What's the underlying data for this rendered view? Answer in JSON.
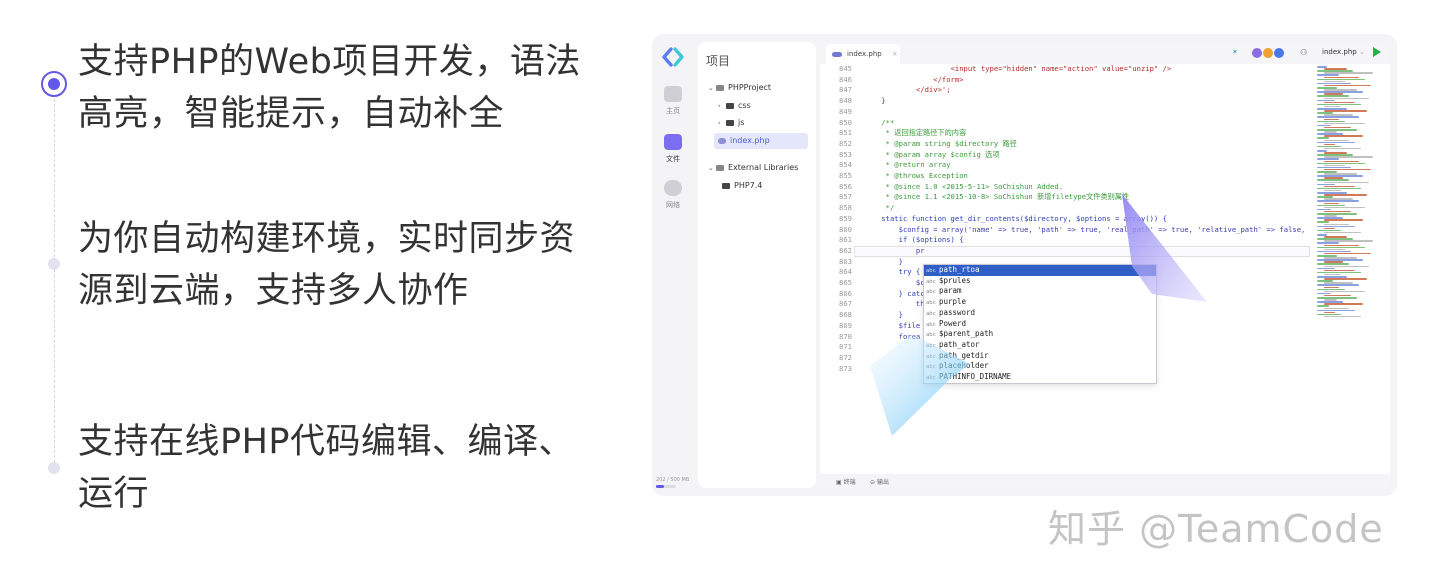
{
  "features": [
    {
      "text": "支持PHP的Web项目开发，语法高亮，智能提示，自动补全",
      "active": true
    },
    {
      "text": "为你自动构建环境，实时同步资源到云端，支持多人协作",
      "active": false
    },
    {
      "text": "支持在线PHP代码编辑、编译、运行",
      "active": false
    }
  ],
  "feature_lines": [
    [
      "支持PHP的Web项目开发，语法",
      "高亮，智能提示，自动补全"
    ],
    [
      "为你自动构建环境，实时同步资",
      "源到云端，支持多人协作"
    ],
    [
      "支持在线PHP代码编辑、编译、",
      "运行"
    ]
  ],
  "ide": {
    "rail": [
      {
        "label": "主页",
        "icon": "home-icon"
      },
      {
        "label": "文件",
        "icon": "folder-icon"
      },
      {
        "label": "网络",
        "icon": "cloud-icon"
      }
    ],
    "storage": "202 / 500 MB",
    "storage_used_fraction": 0.4,
    "tree_title": "项目",
    "tree": [
      {
        "label": "PHPProject",
        "type": "project"
      },
      {
        "label": "css",
        "type": "folder"
      },
      {
        "label": "js",
        "type": "folder"
      },
      {
        "label": "index.php",
        "type": "file"
      },
      {
        "label": "External Libraries",
        "type": "project"
      },
      {
        "label": "PHP7.4",
        "type": "folder"
      }
    ],
    "tab": "index.php",
    "tab_close": "×",
    "file_select": "index.php",
    "code": [
      {
        "n": "845",
        "t": "                    <input type=\"hidden\" name=\"action\" value=\"unzip\" />"
      },
      {
        "n": "846",
        "t": "                </form>"
      },
      {
        "n": "847",
        "t": "            </div>';"
      },
      {
        "n": "848",
        "t": "    }"
      },
      {
        "n": "849",
        "t": ""
      },
      {
        "n": "850",
        "t": "    /**"
      },
      {
        "n": "851",
        "t": "     * 返回指定路径下的内容"
      },
      {
        "n": "852",
        "t": "     * @param string $directory 路径"
      },
      {
        "n": "853",
        "t": "     * @param array $config 选项"
      },
      {
        "n": "854",
        "t": "     * @return array"
      },
      {
        "n": "855",
        "t": "     * @throws Exception"
      },
      {
        "n": "856",
        "t": "     * @since 1.0 <2015-5-11> SoChishun Added."
      },
      {
        "n": "857",
        "t": "     * @since 1.1 <2015-10-8> SoChishun 新增filetype文件类别属性"
      },
      {
        "n": "858",
        "t": "     */"
      },
      {
        "n": "859",
        "t": "    static function get_dir_contents($directory, $options = array()) {"
      },
      {
        "n": "860",
        "t": "        $config = array('name' => true, 'path' => true, 'real_path' => true, 'relative_path' => false,"
      },
      {
        "n": "861",
        "t": "        if ($options) {"
      },
      {
        "n": "862",
        "t": "            pr"
      },
      {
        "n": "863",
        "t": "        }"
      },
      {
        "n": "864",
        "t": "        try {"
      },
      {
        "n": "865",
        "t": "            $c"
      },
      {
        "n": "866",
        "t": "        } catc"
      },
      {
        "n": "867",
        "t": "            th"
      },
      {
        "n": "868",
        "t": "        }"
      },
      {
        "n": "869",
        "t": "        $file"
      },
      {
        "n": "870",
        "t": "        forea"
      },
      {
        "n": "871",
        "t": ""
      },
      {
        "n": "872",
        "t": ""
      },
      {
        "n": "873",
        "t": ""
      }
    ],
    "suggestions": [
      {
        "kind": "abc",
        "text": "path_rtoa"
      },
      {
        "kind": "abc",
        "text": "$prules"
      },
      {
        "kind": "abc",
        "text": "param"
      },
      {
        "kind": "abc",
        "text": "purple"
      },
      {
        "kind": "abc",
        "text": "password"
      },
      {
        "kind": "abc",
        "text": "Powerd"
      },
      {
        "kind": "abc",
        "text": "$parent_path"
      },
      {
        "kind": "abc",
        "text": "path_ator"
      },
      {
        "kind": "abc",
        "text": "path_getdir"
      },
      {
        "kind": "abc",
        "text": "placeholder"
      },
      {
        "kind": "abc",
        "text": "PATHINFO_DIRNAME"
      }
    ],
    "bottom": [
      {
        "label": "终端",
        "icon": "terminal-icon"
      },
      {
        "label": "输出",
        "icon": "output-icon"
      }
    ]
  },
  "watermark": "知乎 @TeamCode",
  "colors": {
    "accent": "#6358e8",
    "selection": "#2f5ec4",
    "comment": "#3a9a3a",
    "keyword": "#2a3fb3",
    "string": "#b22a2a",
    "run": "#22b24c"
  }
}
